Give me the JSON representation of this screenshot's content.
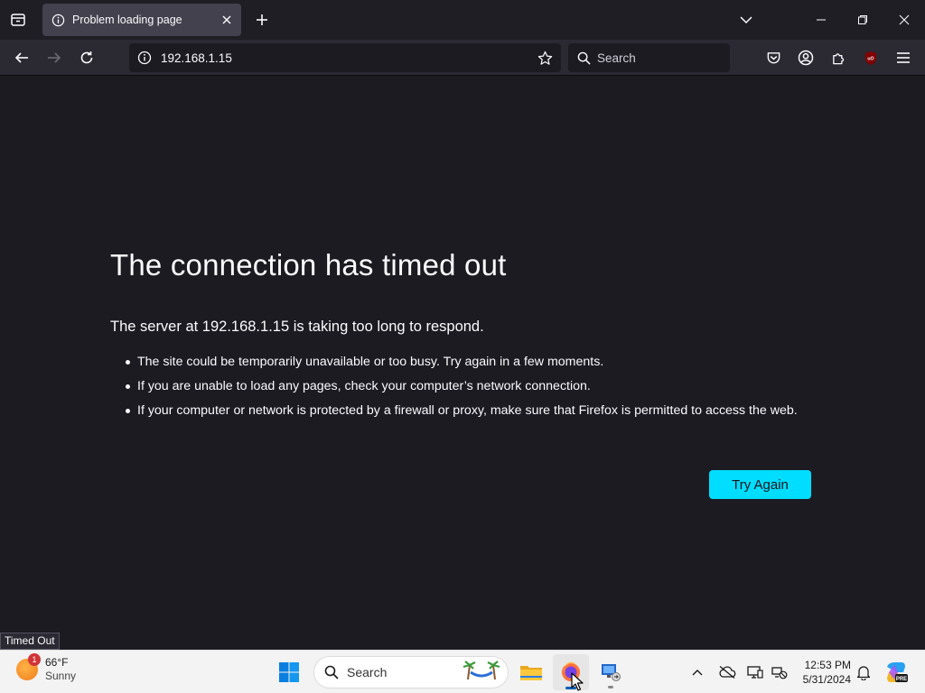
{
  "browser": {
    "tab": {
      "title": "Problem loading page"
    },
    "nav": {
      "url": "192.168.1.15",
      "search_placeholder": "Search"
    }
  },
  "page": {
    "title": "The connection has timed out",
    "intro": "The server at 192.168.1.15 is taking too long to respond.",
    "bullets": [
      "The site could be temporarily unavailable or too busy. Try again in a few moments.",
      "If you are unable to load any pages, check your computer’s network connection.",
      "If your computer or network is protected by a firewall or proxy, make sure that Firefox is permitted to access the web."
    ],
    "try_again": "Try Again",
    "status_tip": "Timed Out"
  },
  "taskbar": {
    "weather": {
      "temp": "66°F",
      "condition": "Sunny",
      "badge": "1"
    },
    "search_label": "Search",
    "time": "12:53 PM",
    "date": "5/31/2024"
  },
  "colors": {
    "accent": "#00ddff",
    "page_bg": "#1c1b22",
    "toolbar_bg": "#2b2a33",
    "tab_active": "#42414d",
    "taskbar_bg": "#f3f3f3",
    "ublock_red": "#800000"
  },
  "icons": {
    "tab_list": "tab-list-icon",
    "tab_info": "info-icon",
    "tab_close": "close-icon",
    "new_tab": "plus-icon",
    "list_all_tabs": "chevron-down-icon",
    "minimize": "minimize-icon",
    "maximize": "restore-icon",
    "close": "window-close-icon",
    "back": "arrow-left-icon",
    "forward": "arrow-right-icon",
    "reload": "reload-icon",
    "bookmark": "star-icon",
    "search": "search-icon",
    "pocket": "pocket-icon",
    "account": "account-icon",
    "extensions": "puzzle-icon",
    "ublock": "ublock-icon",
    "menu": "hamburger-menu-icon"
  }
}
